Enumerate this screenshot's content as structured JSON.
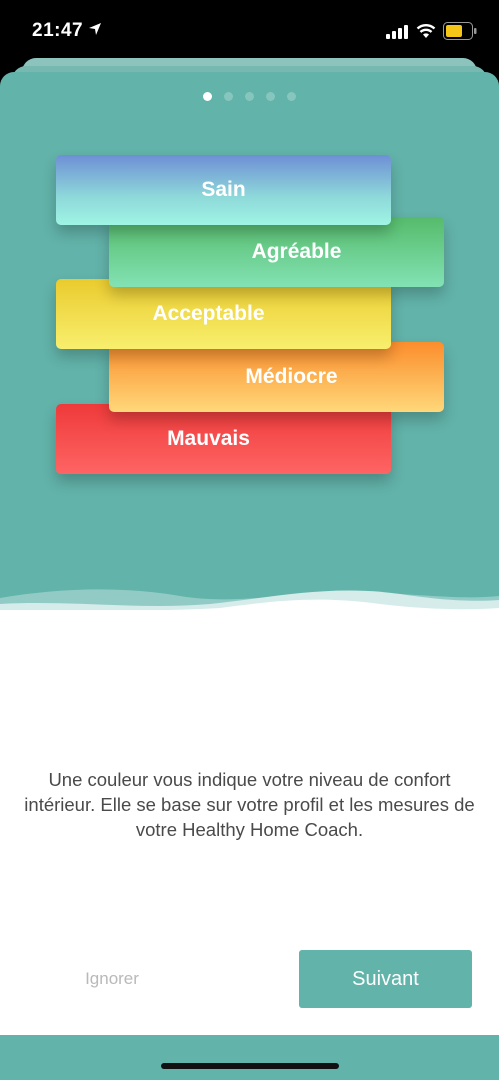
{
  "status_bar": {
    "time": "21:47",
    "icons": [
      "location-arrow-icon",
      "signal-icon",
      "wifi-icon",
      "battery-icon"
    ],
    "battery_color": "#f5c518"
  },
  "pager": {
    "total": 5,
    "current": 1
  },
  "levels": [
    {
      "label": "Sain",
      "color": "#8ed9da"
    },
    {
      "label": "Agréable",
      "color": "#6dd49a"
    },
    {
      "label": "Acceptable",
      "color": "#f2de4a"
    },
    {
      "label": "Médiocre",
      "color": "#fdb052"
    },
    {
      "label": "Mauvais",
      "color": "#f54e4e"
    }
  ],
  "description": "Une couleur vous indique votre niveau de confort intérieur. Elle se base sur votre profil et les mesures de votre Healthy Home Coach.",
  "buttons": {
    "skip": "Ignorer",
    "next": "Suivant"
  },
  "colors": {
    "accent": "#62b3aa",
    "background_card": "#ffffff"
  }
}
